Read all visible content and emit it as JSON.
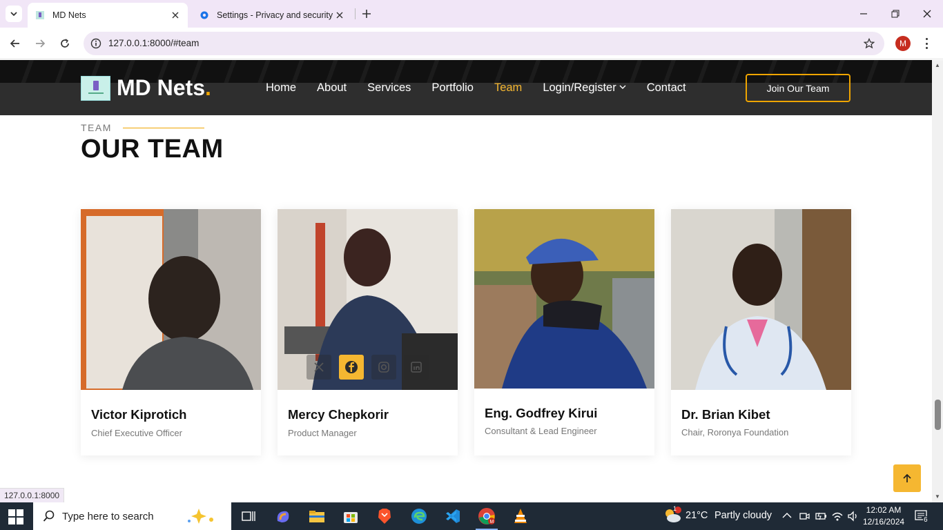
{
  "browser": {
    "tabs": [
      {
        "title": "MD Nets",
        "active": true
      },
      {
        "title": "Settings - Privacy and security",
        "active": false
      }
    ],
    "url": "127.0.0.1:8000/#team",
    "profile_initial": "M",
    "status_url": "127.0.0.1:8000"
  },
  "site": {
    "logo_text": "MD Nets",
    "logo_dot": ".",
    "nav": [
      {
        "label": "Home"
      },
      {
        "label": "About"
      },
      {
        "label": "Services"
      },
      {
        "label": "Portfolio"
      },
      {
        "label": "Team",
        "active": true
      },
      {
        "label": "Login/Register",
        "dropdown": true
      },
      {
        "label": "Contact"
      }
    ],
    "join_button": "Join Our Team",
    "accent_color": "#f5b731"
  },
  "team": {
    "label": "TEAM",
    "title": "OUR TEAM",
    "members": [
      {
        "name": "Victor Kiprotich",
        "role": "Chief Executive Officer"
      },
      {
        "name": "Mercy Chepkorir",
        "role": "Product Manager"
      },
      {
        "name": "Eng. Godfrey Kirui",
        "role": "Consultant & Lead Engineer"
      },
      {
        "name": "Dr. Brian Kibet",
        "role": "Chair, Roronya Foundation"
      }
    ],
    "social_icons": [
      "x-icon",
      "facebook-icon",
      "instagram-icon",
      "linkedin-icon"
    ]
  },
  "taskbar": {
    "search_placeholder": "Type here to search",
    "weather_temp": "21°C",
    "weather_text": "Partly cloudy",
    "weather_badge": "1",
    "time": "12:02 AM",
    "date": "12/16/2024",
    "notification_count": "6"
  }
}
